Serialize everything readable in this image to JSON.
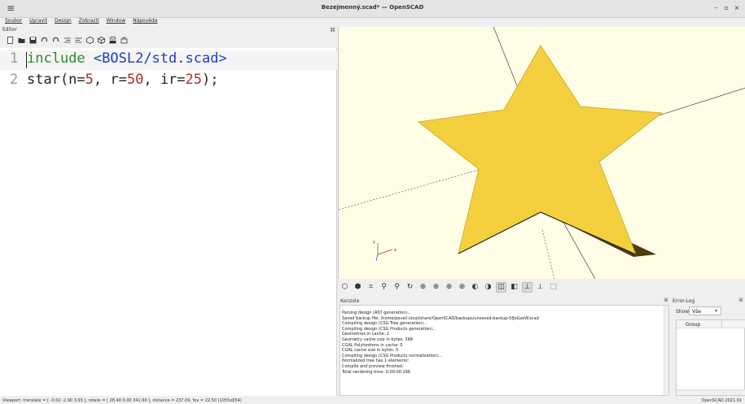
{
  "window": {
    "title": "Bezejmenný.scad* — OpenSCAD",
    "minimize": "–",
    "maximize": "▫",
    "close": "×",
    "menu": "≡"
  },
  "menubar": [
    "Soubor",
    "Upravit",
    "Design",
    "Zobrazit",
    "Window",
    "Nápověda"
  ],
  "editor": {
    "label": "Editor",
    "close": "⌘",
    "lines": [
      {
        "number": "1",
        "keyword": "include",
        "space": " ",
        "path": "<BOSL2/std.scad>"
      },
      {
        "number": "2",
        "fn": "star(n=",
        "n": "5",
        "sep1": ", r=",
        "r": "50",
        "sep2": ", ir=",
        "ir": "25",
        "end": ");"
      }
    ]
  },
  "viewport": {
    "object_color": "#f4d03f",
    "background": "#fffde6",
    "axis_y_label": "y",
    "axis_x_label": "x",
    "axis_z_label": "z"
  },
  "console": {
    "title": "Konzole",
    "lines": [
      "Parsing design (AST generation)...",
      "Saved backup file: /home/pavel/.local/share/OpenSCAD/backups/unsaved-backup-5fJoGzeW.scad",
      "Compiling design (CSG Tree generation)...",
      "Compiling design (CSG Products generation)...",
      "Geometries in cache: 2",
      "Geometry cache size in bytes: 368",
      "CGAL Polyhedrons in cache: 0",
      "CGAL cache size in bytes: 0",
      "Compiling design (CSG Products normalization)...",
      "Normalized tree has 1 elements!",
      "Compile and preview finished.",
      "Total rendering time: 0:00:00.166"
    ]
  },
  "errorlog": {
    "title": "Error-Log",
    "show_label": "Show",
    "show_value": "Vše",
    "column": "Group"
  },
  "statusbar": {
    "viewport": "Viewport: translate = [ -0.02 -2.90 3.93 ], rotate = [ 28.40 0.00 341.60 ], distance = 237.09, fov = 22.50 (1055x654)",
    "version": "OpenSCAD 2021.01"
  }
}
